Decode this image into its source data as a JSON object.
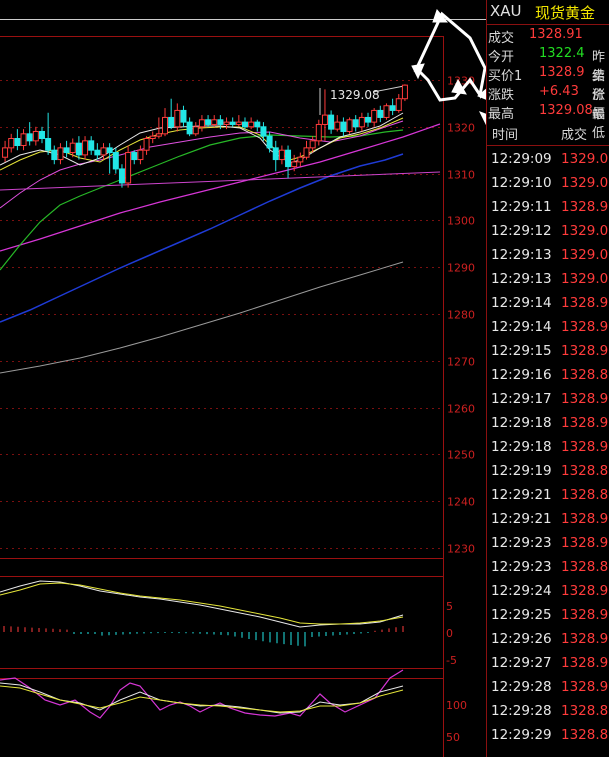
{
  "header": {
    "symbol": "XAU",
    "name": "现货黄金"
  },
  "quotes": [
    {
      "label": "成交",
      "value": "1328.91",
      "color": "#ff3b3b",
      "extra": ""
    },
    {
      "label": "今开",
      "value": "1322.4",
      "color": "#22dd22",
      "extra": "昨结"
    },
    {
      "label": "买价1",
      "value": "1328.9",
      "color": "#ff3b3b",
      "extra": "卖价"
    },
    {
      "label": "涨跌",
      "value": "+6.43",
      "color": "#ff3b3b",
      "extra": "涨幅"
    },
    {
      "label": "最高",
      "value": "1329.08",
      "color": "#ff3b3b",
      "extra": "最低"
    }
  ],
  "ticks_header": {
    "time": "时间",
    "price": "成交"
  },
  "ticks": [
    {
      "time": "12:29:09",
      "price": "1329.0"
    },
    {
      "time": "12:29:10",
      "price": "1329.0"
    },
    {
      "time": "12:29:11",
      "price": "1328.9"
    },
    {
      "time": "12:29:12",
      "price": "1329.0"
    },
    {
      "time": "12:29:13",
      "price": "1329.0"
    },
    {
      "time": "12:29:13",
      "price": "1329.0"
    },
    {
      "time": "12:29:14",
      "price": "1328.9"
    },
    {
      "time": "12:29:14",
      "price": "1328.9"
    },
    {
      "time": "12:29:15",
      "price": "1328.9"
    },
    {
      "time": "12:29:16",
      "price": "1328.8"
    },
    {
      "time": "12:29:17",
      "price": "1328.9"
    },
    {
      "time": "12:29:18",
      "price": "1328.9"
    },
    {
      "time": "12:29:18",
      "price": "1328.9"
    },
    {
      "time": "12:29:19",
      "price": "1328.8"
    },
    {
      "time": "12:29:21",
      "price": "1328.8"
    },
    {
      "time": "12:29:21",
      "price": "1328.9"
    },
    {
      "time": "12:29:23",
      "price": "1328.9"
    },
    {
      "time": "12:29:23",
      "price": "1328.8"
    },
    {
      "time": "12:29:24",
      "price": "1328.9"
    },
    {
      "time": "12:29:25",
      "price": "1328.9"
    },
    {
      "time": "12:29:26",
      "price": "1328.9"
    },
    {
      "time": "12:29:27",
      "price": "1328.9"
    },
    {
      "time": "12:29:28",
      "price": "1328.9"
    },
    {
      "time": "12:29:28",
      "price": "1328.8"
    },
    {
      "time": "12:29:29",
      "price": "1328.8"
    }
  ],
  "chart_data": {
    "type": "candlestick",
    "high_label": "1329.08",
    "price_axis_ticks": [
      1330,
      1320,
      1310,
      1300,
      1290,
      1280,
      1270,
      1260,
      1250,
      1240,
      1230
    ],
    "price_range": [
      1229,
      1333
    ],
    "macd_axis_ticks": [
      "5",
      "0",
      "-5"
    ],
    "kdj_axis_ticks": [
      "100",
      "50"
    ],
    "candles": [
      {
        "o": 1313.5,
        "c": 1315.5,
        "h": 1317.0,
        "l": 1312.5
      },
      {
        "o": 1315.5,
        "c": 1317.5,
        "h": 1318.5,
        "l": 1314.5
      },
      {
        "o": 1317.5,
        "c": 1316.0,
        "h": 1319.5,
        "l": 1315.0
      },
      {
        "o": 1316.0,
        "c": 1318.5,
        "h": 1319.5,
        "l": 1315.0
      },
      {
        "o": 1318.5,
        "c": 1317.0,
        "h": 1321.0,
        "l": 1316.0
      },
      {
        "o": 1317.0,
        "c": 1319.0,
        "h": 1320.0,
        "l": 1316.0
      },
      {
        "o": 1319.0,
        "c": 1317.5,
        "h": 1320.0,
        "l": 1316.5
      },
      {
        "o": 1317.5,
        "c": 1315.0,
        "h": 1323.0,
        "l": 1314.0
      },
      {
        "o": 1315.0,
        "c": 1313.0,
        "h": 1316.0,
        "l": 1312.0
      },
      {
        "o": 1313.0,
        "c": 1315.5,
        "h": 1316.5,
        "l": 1312.0
      },
      {
        "o": 1315.5,
        "c": 1314.5,
        "h": 1317.0,
        "l": 1313.5
      },
      {
        "o": 1314.5,
        "c": 1316.5,
        "h": 1317.5,
        "l": 1313.5
      },
      {
        "o": 1316.5,
        "c": 1314.0,
        "h": 1318.0,
        "l": 1313.0
      },
      {
        "o": 1314.0,
        "c": 1317.0,
        "h": 1318.0,
        "l": 1313.0
      },
      {
        "o": 1317.0,
        "c": 1315.0,
        "h": 1318.0,
        "l": 1314.0
      },
      {
        "o": 1315.0,
        "c": 1314.0,
        "h": 1316.5,
        "l": 1313.0
      },
      {
        "o": 1314.0,
        "c": 1315.5,
        "h": 1316.5,
        "l": 1313.0
      },
      {
        "o": 1315.5,
        "c": 1314.5,
        "h": 1316.5,
        "l": 1310.0
      },
      {
        "o": 1314.5,
        "c": 1311.0,
        "h": 1315.5,
        "l": 1310.0
      },
      {
        "o": 1311.0,
        "c": 1308.0,
        "h": 1312.0,
        "l": 1307.0
      },
      {
        "o": 1308.0,
        "c": 1314.5,
        "h": 1316.0,
        "l": 1307.0
      },
      {
        "o": 1314.5,
        "c": 1313.0,
        "h": 1315.0,
        "l": 1312.0
      },
      {
        "o": 1313.0,
        "c": 1315.0,
        "h": 1316.0,
        "l": 1312.0
      },
      {
        "o": 1315.0,
        "c": 1317.5,
        "h": 1318.0,
        "l": 1314.0
      },
      {
        "o": 1317.5,
        "c": 1318.0,
        "h": 1319.0,
        "l": 1316.5
      },
      {
        "o": 1318.0,
        "c": 1318.5,
        "h": 1322.0,
        "l": 1317.5
      },
      {
        "o": 1318.5,
        "c": 1322.0,
        "h": 1324.0,
        "l": 1318.0
      },
      {
        "o": 1322.0,
        "c": 1320.0,
        "h": 1326.0,
        "l": 1319.5
      },
      {
        "o": 1320.0,
        "c": 1323.5,
        "h": 1325.0,
        "l": 1319.0
      },
      {
        "o": 1323.5,
        "c": 1321.0,
        "h": 1324.5,
        "l": 1320.0
      },
      {
        "o": 1321.0,
        "c": 1318.5,
        "h": 1322.0,
        "l": 1318.0
      },
      {
        "o": 1318.5,
        "c": 1320.0,
        "h": 1321.0,
        "l": 1318.0
      },
      {
        "o": 1320.0,
        "c": 1321.5,
        "h": 1322.5,
        "l": 1319.0
      },
      {
        "o": 1321.5,
        "c": 1320.5,
        "h": 1322.5,
        "l": 1320.0
      },
      {
        "o": 1320.5,
        "c": 1321.5,
        "h": 1322.5,
        "l": 1320.0
      },
      {
        "o": 1321.5,
        "c": 1320.5,
        "h": 1322.5,
        "l": 1319.5
      },
      {
        "o": 1320.5,
        "c": 1321.0,
        "h": 1322.0,
        "l": 1319.5
      },
      {
        "o": 1321.0,
        "c": 1320.5,
        "h": 1322.0,
        "l": 1320.0
      },
      {
        "o": 1320.5,
        "c": 1321.0,
        "h": 1322.5,
        "l": 1320.0
      },
      {
        "o": 1321.0,
        "c": 1320.0,
        "h": 1322.0,
        "l": 1319.5
      },
      {
        "o": 1320.0,
        "c": 1321.0,
        "h": 1322.0,
        "l": 1319.5
      },
      {
        "o": 1321.0,
        "c": 1320.0,
        "h": 1321.5,
        "l": 1319.0
      },
      {
        "o": 1320.0,
        "c": 1318.0,
        "h": 1321.0,
        "l": 1317.0
      },
      {
        "o": 1318.0,
        "c": 1315.5,
        "h": 1319.0,
        "l": 1314.5
      },
      {
        "o": 1315.5,
        "c": 1313.0,
        "h": 1317.0,
        "l": 1310.5
      },
      {
        "o": 1313.0,
        "c": 1315.0,
        "h": 1316.0,
        "l": 1312.0
      },
      {
        "o": 1315.0,
        "c": 1311.5,
        "h": 1316.0,
        "l": 1309.0
      },
      {
        "o": 1311.5,
        "c": 1312.5,
        "h": 1314.0,
        "l": 1310.5
      },
      {
        "o": 1312.5,
        "c": 1313.5,
        "h": 1314.5,
        "l": 1311.5
      },
      {
        "o": 1313.5,
        "c": 1315.5,
        "h": 1317.0,
        "l": 1313.0
      },
      {
        "o": 1315.5,
        "c": 1317.0,
        "h": 1318.0,
        "l": 1314.5
      },
      {
        "o": 1317.0,
        "c": 1320.5,
        "h": 1321.5,
        "l": 1316.0
      },
      {
        "o": 1320.5,
        "c": 1322.5,
        "h": 1328.0,
        "l": 1317.0
      },
      {
        "o": 1322.5,
        "c": 1319.5,
        "h": 1323.5,
        "l": 1318.5
      },
      {
        "o": 1319.5,
        "c": 1321.0,
        "h": 1322.5,
        "l": 1319.0
      },
      {
        "o": 1321.0,
        "c": 1319.0,
        "h": 1322.0,
        "l": 1318.0
      },
      {
        "o": 1319.0,
        "c": 1321.5,
        "h": 1322.0,
        "l": 1318.5
      },
      {
        "o": 1321.5,
        "c": 1320.0,
        "h": 1322.5,
        "l": 1319.0
      },
      {
        "o": 1320.0,
        "c": 1322.0,
        "h": 1323.0,
        "l": 1319.0
      },
      {
        "o": 1322.0,
        "c": 1321.0,
        "h": 1323.0,
        "l": 1320.0
      },
      {
        "o": 1321.0,
        "c": 1323.5,
        "h": 1324.0,
        "l": 1320.0
      },
      {
        "o": 1323.5,
        "c": 1322.0,
        "h": 1324.5,
        "l": 1321.0
      },
      {
        "o": 1322.0,
        "c": 1324.5,
        "h": 1325.0,
        "l": 1321.5
      },
      {
        "o": 1324.5,
        "c": 1323.5,
        "h": 1326.0,
        "l": 1322.5
      },
      {
        "o": 1323.5,
        "c": 1326.0,
        "h": 1327.0,
        "l": 1323.0
      },
      {
        "o": 1326.0,
        "c": 1328.9,
        "h": 1329.08,
        "l": 1325.5
      }
    ]
  }
}
